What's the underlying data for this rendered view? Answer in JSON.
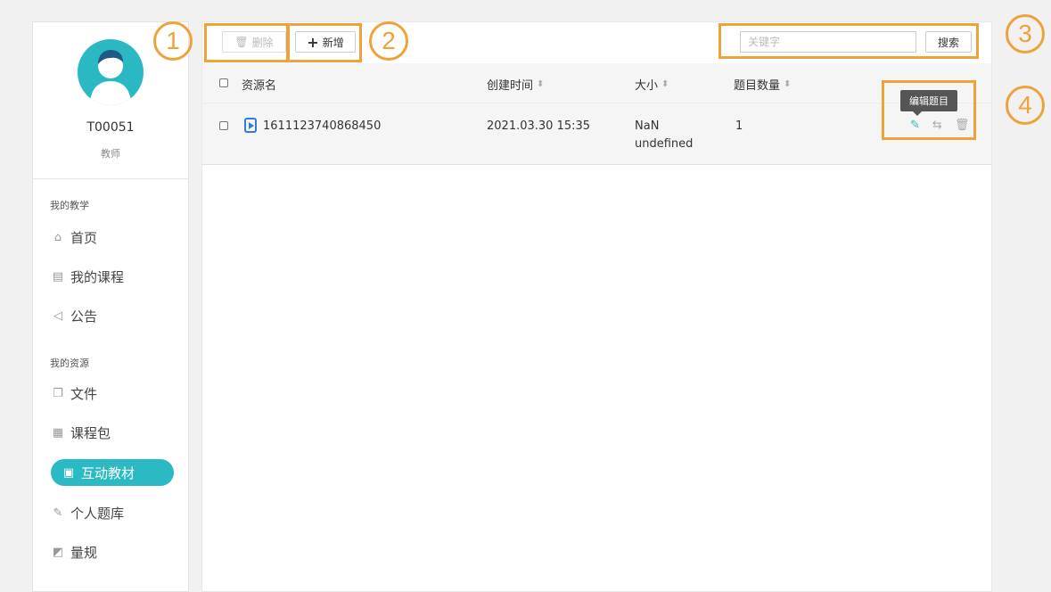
{
  "user": {
    "name": "T00051",
    "role": "教师"
  },
  "sidebar": {
    "sections": [
      {
        "title": "我的教学"
      },
      {
        "title": "我的资源"
      }
    ],
    "items": [
      {
        "label": "首页",
        "icon": "home-icon"
      },
      {
        "label": "我的课程",
        "icon": "course-doc-icon"
      },
      {
        "label": "公告",
        "icon": "megaphone-icon"
      },
      {
        "label": "文件",
        "icon": "file-copy-icon"
      },
      {
        "label": "课程包",
        "icon": "package-grid-icon"
      },
      {
        "label": "互动教材",
        "icon": "interactive-book-icon"
      },
      {
        "label": "个人题库",
        "icon": "question-bank-icon"
      },
      {
        "label": "量规",
        "icon": "rubric-icon"
      }
    ]
  },
  "toolbar": {
    "delete_label": "删除",
    "add_label": "新增",
    "search_placeholder": "关键字",
    "search_label": "搜索"
  },
  "table": {
    "columns": [
      "资源名",
      "创建时间",
      "大小",
      "题目数量"
    ],
    "rows": [
      {
        "name": "1611123740868450",
        "created": "2021.03.30 15:35",
        "size_line1": "NaN",
        "size_line2": "undefined",
        "count": "1"
      }
    ],
    "tooltip": "编辑题目"
  },
  "annotations": [
    "1",
    "2",
    "3",
    "4"
  ],
  "colors": {
    "accent": "#2bbac3",
    "highlight": "#f0a23a",
    "file_icon": "#2f7de1"
  }
}
